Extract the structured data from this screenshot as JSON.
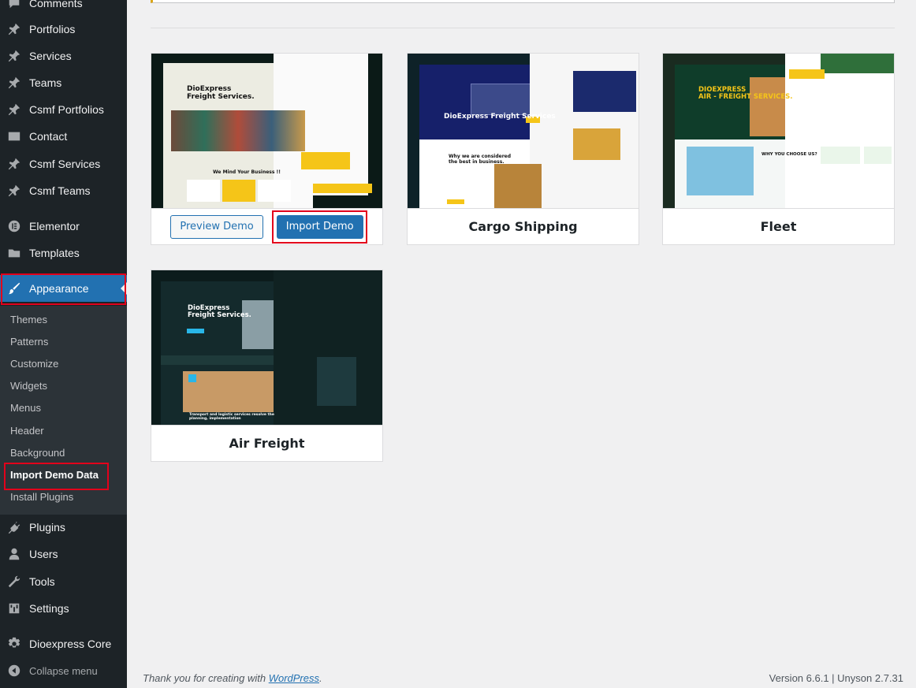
{
  "sidebar": {
    "items": [
      {
        "label": "Comments",
        "icon": "comment-icon"
      },
      {
        "label": "Portfolios",
        "icon": "pin-icon"
      },
      {
        "label": "Services",
        "icon": "pin-icon"
      },
      {
        "label": "Teams",
        "icon": "pin-icon"
      },
      {
        "label": "Csmf Portfolios",
        "icon": "pin-icon"
      },
      {
        "label": "Contact",
        "icon": "mail-icon"
      },
      {
        "label": "Csmf Services",
        "icon": "pin-icon"
      },
      {
        "label": "Csmf Teams",
        "icon": "pin-icon"
      },
      {
        "label": "Elementor",
        "icon": "elementor-icon"
      },
      {
        "label": "Templates",
        "icon": "folder-icon"
      },
      {
        "label": "Appearance",
        "icon": "brush-icon"
      },
      {
        "label": "Plugins",
        "icon": "plugin-icon"
      },
      {
        "label": "Users",
        "icon": "user-icon"
      },
      {
        "label": "Tools",
        "icon": "wrench-icon"
      },
      {
        "label": "Settings",
        "icon": "settings-icon"
      },
      {
        "label": "Dioexpress Core",
        "icon": "gear-icon"
      },
      {
        "label": "Collapse menu",
        "icon": "collapse-icon"
      }
    ],
    "submenu": [
      "Themes",
      "Patterns",
      "Customize",
      "Widgets",
      "Menus",
      "Header",
      "Background",
      "Import Demo Data",
      "Install Plugins"
    ]
  },
  "demos": [
    {
      "title": "",
      "preview_label": "Preview Demo",
      "import_label": "Import Demo",
      "thumb_heading": "DioExpress\nFreight Services.",
      "thumb_sub": "We Mind Your Business !!"
    },
    {
      "title": "Cargo Shipping",
      "thumb_heading": "DioExpress Freight Services",
      "thumb_sub": "Why we are considered\nthe best in business."
    },
    {
      "title": "Fleet",
      "thumb_heading": "DIOEXPRESS\nAIR - FREIGHT SERVICES.",
      "thumb_sub": "WHY YOU CHOOSE US?"
    },
    {
      "title": "Air Freight",
      "thumb_heading": "DioExpress\nFreight Services.",
      "thumb_sub": "Transport and logistic services resolve the planning, implementation"
    }
  ],
  "footer": {
    "thanks_prefix": "Thank you for creating with ",
    "link": "WordPress",
    "thanks_suffix": ".",
    "version": "Version 6.6.1 | Unyson 2.7.31"
  },
  "colors": {
    "sidebar_bg": "#1d2327",
    "submenu_bg": "#2c3338",
    "accent": "#2271b1",
    "highlight_box": "#e3001b",
    "page_bg": "#f0f0f1"
  }
}
